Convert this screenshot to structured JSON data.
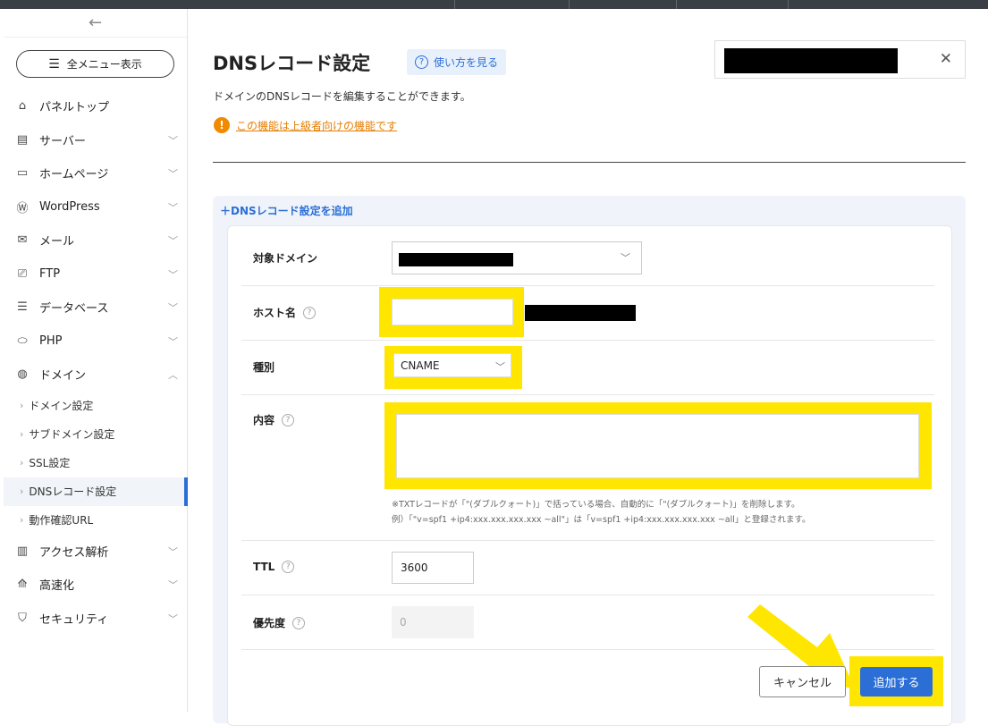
{
  "sidebar": {
    "back_icon": "arrow-left-icon",
    "menu_button": "全メニュー表示",
    "items": [
      {
        "label": "パネルトップ",
        "icon": "home-icon",
        "glyph": "⌂",
        "chevron": false
      },
      {
        "label": "サーバー",
        "icon": "server-icon",
        "glyph": "▤",
        "chevron": true
      },
      {
        "label": "ホームページ",
        "icon": "browser-icon",
        "glyph": "▭",
        "chevron": true
      },
      {
        "label": "WordPress",
        "icon": "wordpress-icon",
        "glyph": "Ⓦ",
        "chevron": true
      },
      {
        "label": "メール",
        "icon": "mail-icon",
        "glyph": "✉",
        "chevron": true
      },
      {
        "label": "FTP",
        "icon": "monitor-icon",
        "glyph": "⎚",
        "chevron": true
      },
      {
        "label": "データベース",
        "icon": "database-icon",
        "glyph": "☰",
        "chevron": true
      },
      {
        "label": "PHP",
        "icon": "php-icon",
        "glyph": "⬭",
        "chevron": true
      },
      {
        "label": "ドメイン",
        "icon": "globe-icon",
        "glyph": "◍",
        "chevron": true
      }
    ],
    "subitems": [
      {
        "label": "ドメイン設定",
        "active": false
      },
      {
        "label": "サブドメイン設定",
        "active": false
      },
      {
        "label": "SSL設定",
        "active": false
      },
      {
        "label": "DNSレコード設定",
        "active": true
      },
      {
        "label": "動作確認URL",
        "active": false
      }
    ],
    "items_after": [
      {
        "label": "アクセス解析",
        "icon": "chart-icon",
        "glyph": "▥",
        "chevron": true
      },
      {
        "label": "高速化",
        "icon": "speed-icon",
        "glyph": "⟰",
        "chevron": true
      },
      {
        "label": "セキュリティ",
        "icon": "shield-icon",
        "glyph": "⛉",
        "chevron": true
      }
    ]
  },
  "header": {
    "title": "DNSレコード設定",
    "help_label": "使い方を見る",
    "close_icon": "close-icon"
  },
  "main": {
    "description": "ドメインのDNSレコードを編集することができます。",
    "warning_link": "この機能は上級者向けの機能です",
    "add_link": "DNSレコード設定を追加"
  },
  "form": {
    "domain_label": "対象ドメイン",
    "host_label": "ホスト名",
    "host_value": "",
    "type_label": "種別",
    "type_value": "CNAME",
    "content_label": "内容",
    "content_value": "",
    "note_line1": "※TXTレコードが「\"(ダブルクォート)」で括っている場合、自動的に「\"(ダブルクォート)」を削除します。",
    "note_line2": "例）「\"v=spf1 +ip4:xxx.xxx.xxx.xxx ~all\"」は「v=spf1 +ip4:xxx.xxx.xxx.xxx ~all」と登録されます。",
    "ttl_label": "TTL",
    "ttl_value": "3600",
    "priority_label": "優先度",
    "priority_value": "0",
    "cancel_label": "キャンセル",
    "submit_label": "追加する"
  },
  "colors": {
    "accent": "#2b6fd6",
    "highlight": "#ffe600",
    "warning": "#f08a00"
  }
}
